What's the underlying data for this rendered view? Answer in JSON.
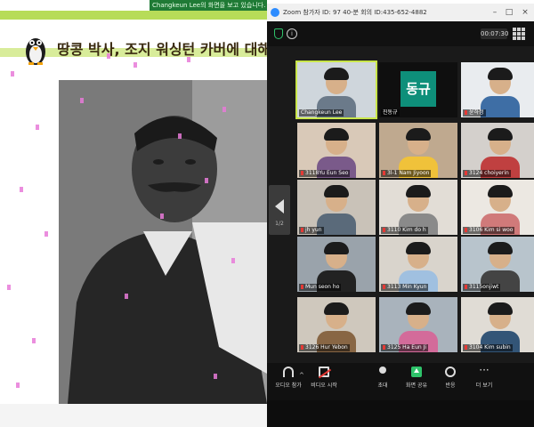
{
  "slide": {
    "share_banner": "Changkeun Lee의 화면을 보고 있습니다.",
    "title": "땅콩 박사, 조지 워싱턴 카버에 대해 알아"
  },
  "zoom": {
    "window_title": "Zoom 참가자 ID: 97    40-분 회의 ID:435-652-4882",
    "timer": "00:07:30",
    "page_indicator": "1/2",
    "participants": [
      {
        "name": "Changkeun Lee",
        "type": "video",
        "active": true,
        "muted": false
      },
      {
        "name": "진동규",
        "type": "namecard",
        "card_text": "동규",
        "muted": false
      },
      {
        "name": "윤하정",
        "type": "video",
        "muted": true
      },
      {
        "name": "3118Yu Eun Seo",
        "type": "video",
        "muted": true
      },
      {
        "name": "3l-1 Nam Jiyoon",
        "type": "video",
        "muted": true
      },
      {
        "name": "3124 choiyerin",
        "type": "video",
        "muted": true
      },
      {
        "name": "jh yun",
        "type": "video",
        "muted": true
      },
      {
        "name": "3110 Kim do h",
        "type": "video",
        "muted": true
      },
      {
        "name": "3106 Kim si woo",
        "type": "video",
        "muted": true
      },
      {
        "name": "Mun seon ho",
        "type": "video",
        "muted": true
      },
      {
        "name": "3113 Min Kyun",
        "type": "video",
        "muted": true
      },
      {
        "name": "3115onjiwt",
        "type": "video",
        "muted": true
      },
      {
        "name": "3126 Hur Yebon",
        "type": "video",
        "muted": true
      },
      {
        "name": "3125 Ha Eun Ji",
        "type": "video",
        "muted": true
      },
      {
        "name": "3104 Kim subin",
        "type": "video",
        "muted": true
      }
    ],
    "toolbar": {
      "audio": "오디오 참가",
      "video": "비디오 시작",
      "invite": "초대",
      "share": "화면 공유",
      "react": "반응",
      "more": "더 보기"
    }
  }
}
